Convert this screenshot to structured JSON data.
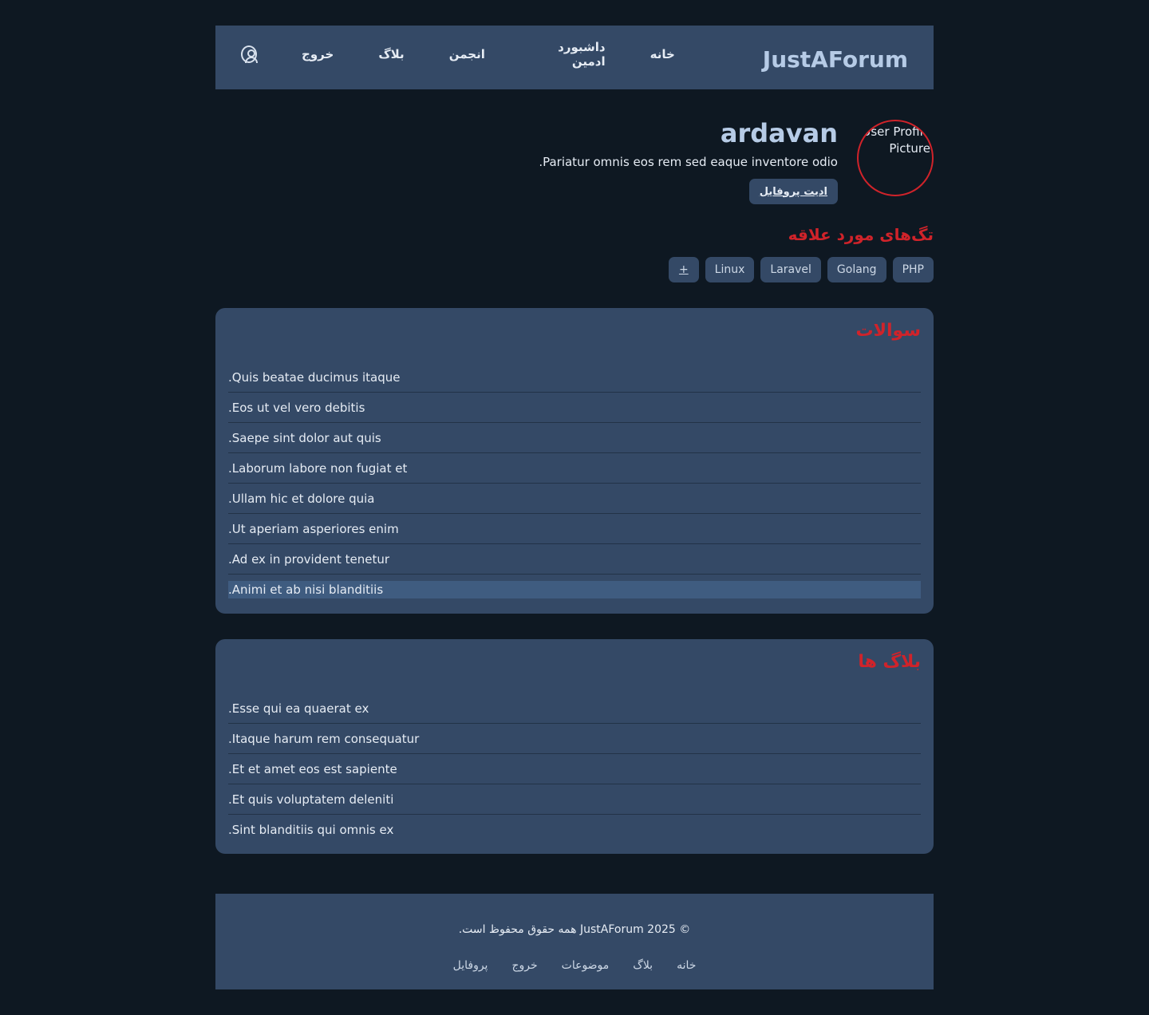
{
  "header": {
    "brand": "JustAForum",
    "nav": [
      "خانه",
      "داشبورد ادمین",
      "انجمن",
      "بلاگ",
      "خروج"
    ]
  },
  "profile": {
    "avatar_alt": "User Profile Picture",
    "username": "ardavan",
    "bio": "Pariatur omnis eos rem sed eaque inventore odio.",
    "edit_button": "ادیت پروفایل"
  },
  "tags": {
    "title": "تگ‌های مورد علاقه",
    "items": [
      "PHP",
      "Golang",
      "Laravel",
      "Linux"
    ],
    "add_label": "+"
  },
  "questions": {
    "title": "سوالات",
    "items": [
      "Quis beatae ducimus itaque.",
      "Eos ut vel vero debitis.",
      "Saepe sint dolor aut quis.",
      "Laborum labore non fugiat et.",
      "Ullam hic et dolore quia.",
      "Ut aperiam asperiores enim.",
      "Ad ex in provident tenetur.",
      "Animi et ab nisi blanditiis."
    ]
  },
  "blogs": {
    "title": "بلاگ ها",
    "items": [
      "Esse qui ea quaerat ex.",
      "Itaque harum rem consequatur.",
      "Et et amet eos est sapiente.",
      "Et quis voluptatem deleniti.",
      "Sint blanditiis qui omnis ex."
    ]
  },
  "footer": {
    "copyright": "© 2025 JustAForum همه حقوق محفوظ است.",
    "links": [
      "خانه",
      "بلاگ",
      "موضوعات",
      "خروج",
      "پروفایل"
    ]
  },
  "colors": {
    "background": "#0e1822",
    "surface": "#344966",
    "accent_red": "#d0232a",
    "brand_blue": "#b6cbe6"
  }
}
